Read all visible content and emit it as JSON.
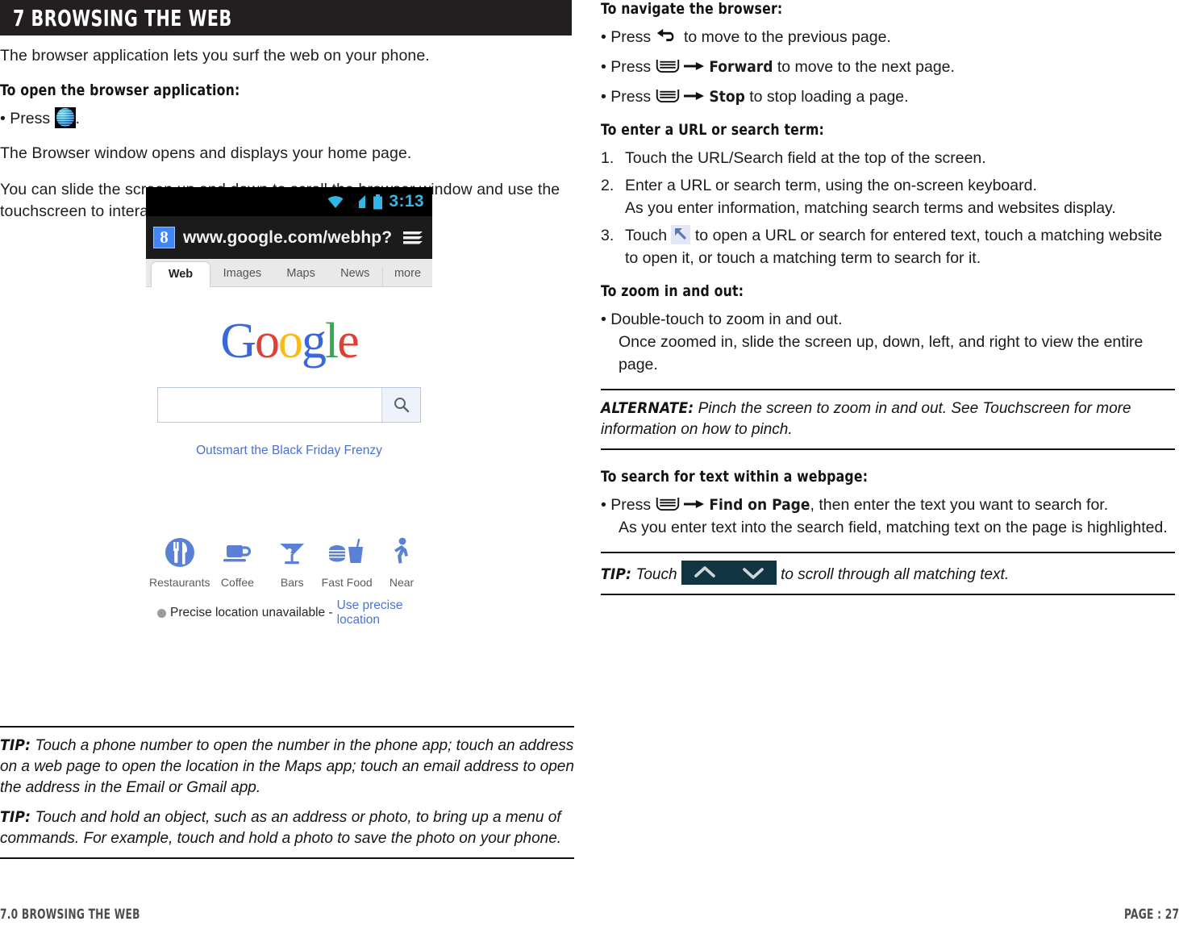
{
  "chapter": {
    "title": "7 BROWSING THE WEB"
  },
  "left": {
    "intro": "The browser application lets you surf the web on your phone.",
    "open_heading": "To open the browser application:",
    "open_bullet_pre": "• Press",
    "open_bullet_post": ".",
    "after_open": "The Browser window opens and displays your home page.",
    "scroll_para": "You can slide the screen up and down to scroll the browser window and use the touchscreen to interact with the web page.",
    "tips": [
      {
        "label": "TIP:",
        "text": " Touch a phone number to open the number in the phone app; touch an address on a web page to open the location in the Maps app; touch an email address to open the address in the Email or Gmail app."
      },
      {
        "label": "TIP:",
        "text": " Touch and hold an object, such as an address or photo, to bring up a menu of commands. For example, touch and hold a photo to save the photo on your phone."
      }
    ]
  },
  "screenshot": {
    "status": {
      "time": "3:13",
      "wifi_icon": "wifi-icon",
      "signal_icon": "signal-icon",
      "battery_icon": "battery-icon"
    },
    "url": "www.google.com/webhp?",
    "google_badge": "8",
    "menu_icon": "browser-menu-icon",
    "tabs": [
      "Web",
      "Images",
      "Maps",
      "News",
      "more"
    ],
    "logo_letters": [
      {
        "ch": "G",
        "color": "#3b68d8"
      },
      {
        "ch": "o",
        "color": "#e04033"
      },
      {
        "ch": "o",
        "color": "#f7bb1b"
      },
      {
        "ch": "g",
        "color": "#3b68d8"
      },
      {
        "ch": "l",
        "color": "#3aa757"
      },
      {
        "ch": "e",
        "color": "#e04033"
      }
    ],
    "search_value": "",
    "search_icon": "magnifier-icon",
    "promo": "Outsmart the Black Friday Frenzy",
    "quick_links": [
      {
        "label": "Restaurants",
        "icon": "restaurant-icon"
      },
      {
        "label": "Coffee",
        "icon": "coffee-icon"
      },
      {
        "label": "Bars",
        "icon": "bars-icon"
      },
      {
        "label": "Fast Food",
        "icon": "fastfood-icon"
      },
      {
        "label": "Near",
        "icon": "walking-icon"
      }
    ],
    "location_text": "Precise location unavailable - ",
    "location_link": "Use precise location"
  },
  "right": {
    "navigate_heading": "To navigate the browser:",
    "nav_b1_pre": "• Press",
    "nav_b1_post": "to move to the previous page.",
    "nav_b2_pre": "• Press",
    "nav_b2_bold": "Forward",
    "nav_b2_post": "to move to the next page.",
    "nav_b3_pre": "• Press",
    "nav_b3_bold": "Stop",
    "nav_b3_post": "to stop loading a page.",
    "url_heading": "To enter a URL or search term:",
    "url_step1": "Touch the URL/Search field at the top of the screen.",
    "url_step2": "Enter a URL or search term, using the on-screen keyboard.",
    "url_step2_cont": "As you enter information, matching search terms and websites display.",
    "url_step3_pre": "Touch",
    "url_step3_post": "to open a URL or search for entered text, touch a matching website to open it, or touch a matching term to search for it.",
    "zoom_heading": "To zoom in and out:",
    "zoom_bullet": "• Double-touch to zoom in and out.",
    "zoom_cont": "Once zoomed in, slide the screen up, down, left, and right to view the entire page.",
    "alternate_label": "ALTERNATE:",
    "alternate_text": " Pinch the screen to zoom in and out. See Touchscreen for more information on how to pinch.",
    "find_heading": "To search for text within a webpage:",
    "find_pre": "• Press",
    "find_bold": "Find on Page",
    "find_post": ", then enter the text you want to search for.",
    "find_cont": "As you enter text into the search field, matching text on the page is highlighted.",
    "tip_label": "TIP:",
    "tip_pre": " Touch",
    "tip_post": " to scroll through all matching text.",
    "chevron_up_icon": "chevron-up-icon",
    "chevron_down_icon": "chevron-down-icon"
  },
  "footer": {
    "left": "7.0 BROWSING THE WEB",
    "right": "PAGE : 27"
  },
  "colors": {
    "header_bg": "#231f20",
    "accent_blue": "#4285f4",
    "tip_box": "#123544",
    "android_cyan": "#33b5e5"
  }
}
